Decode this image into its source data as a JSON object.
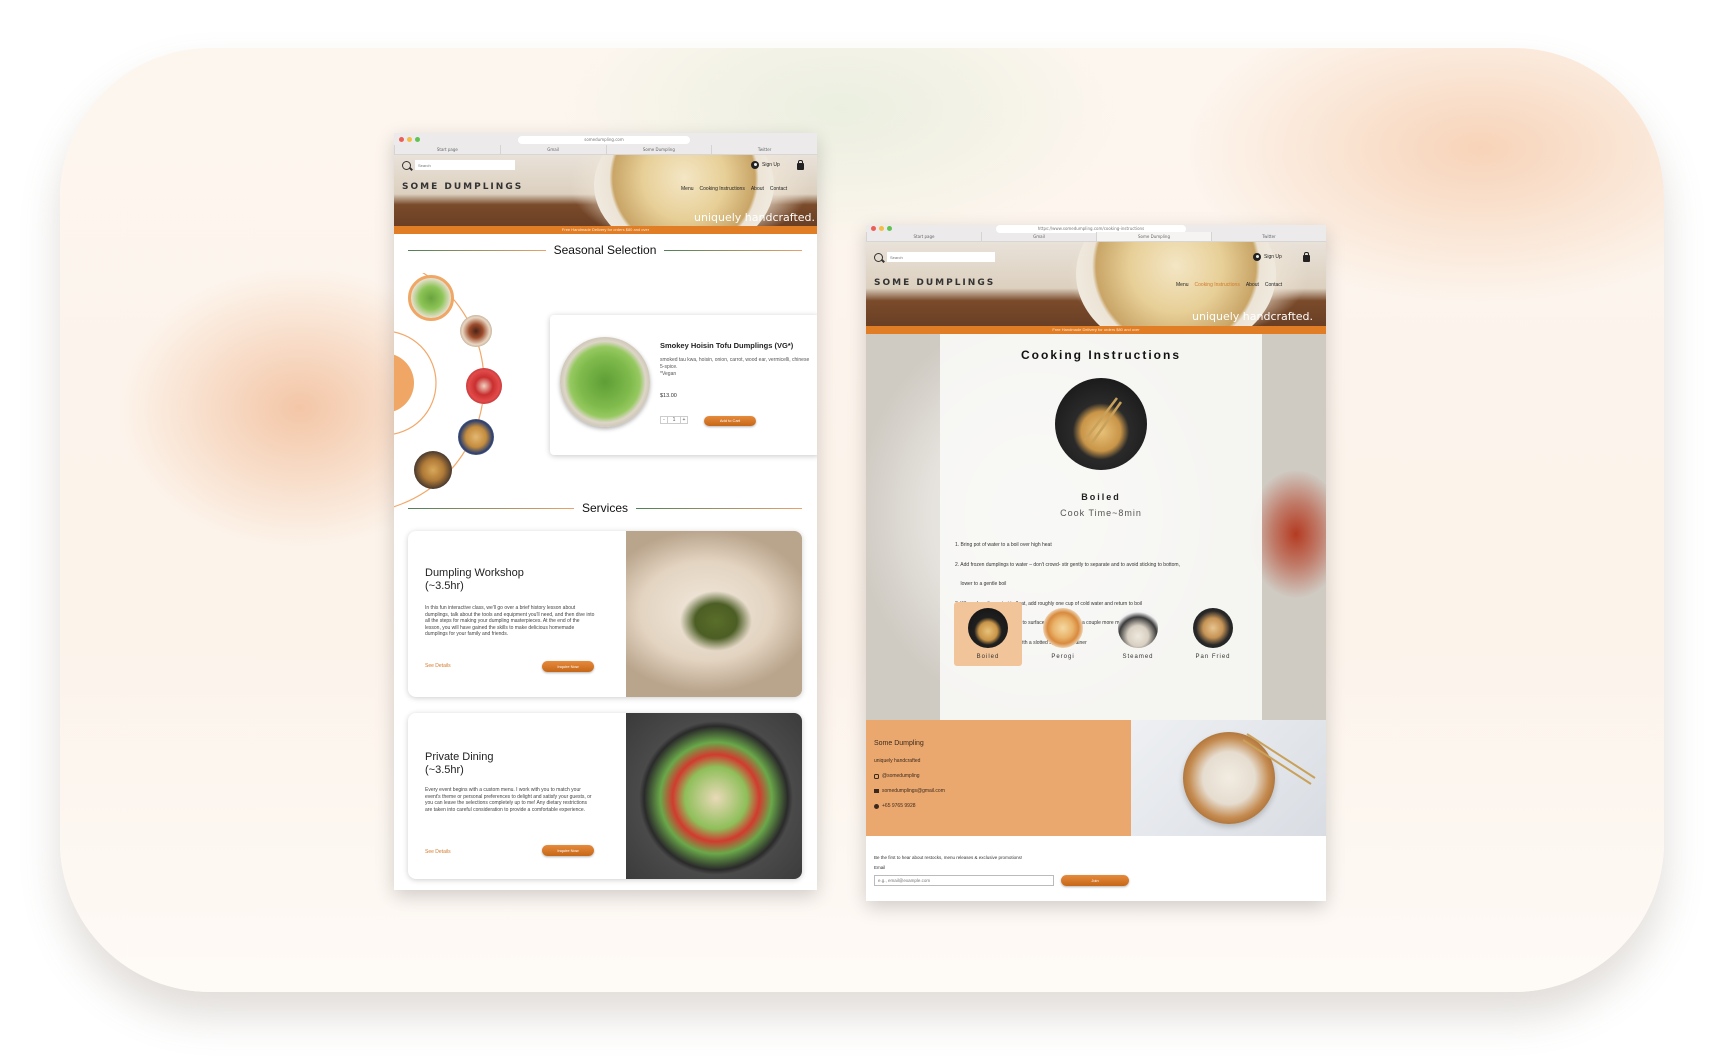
{
  "left_window": {
    "browser": {
      "url": "somedumpling.com",
      "tabs": [
        "Start page",
        "Gmail",
        "Some Dumpling",
        "Twitter"
      ]
    },
    "header": {
      "search_placeholder": "Search",
      "brand": "SOME DUMPLINGS",
      "signup": "Sign Up",
      "nav": [
        "Menu",
        "Cooking Instructions",
        "About",
        "Contact"
      ],
      "tagline": "uniquely handcrafted.",
      "promo": "Free Handmade Delivery for orders $80 and over"
    },
    "seasonal": {
      "title": "Seasonal Selection",
      "product": {
        "name": "Smokey Hoisin Tofu Dumplings (VG*)",
        "description": "smoked tau kwa, hoisin, onion, carrot, wood ear, vermicelli, chinese 5-spice.",
        "note": "*Vegan",
        "price": "$13.00",
        "qty_minus": "-",
        "qty": "1",
        "qty_plus": "+",
        "add_to_cart": "Add to Cart"
      }
    },
    "services": {
      "title": "Services",
      "cards": [
        {
          "title_line1": "Dumpling Workshop",
          "title_line2": "(~3.5hr)",
          "text": "In this fun interactive class, we'll go over a brief history lesson about dumplings, talk about the tools and equipment you'll need, and then dive into all the steps for making your dumpling masterpieces. At the end of the lesson, you will have gained the skills to make delicious homemade dumplings for your family and friends.",
          "details": "See Details",
          "button": "Inquire Now"
        },
        {
          "title_line1": "Private Dining",
          "title_line2": "(~3.5hr)",
          "text": "Every event begins with a custom menu. I work with you to match your event's theme or personal preferences to delight and satisfy your guests, or you can leave the selections completely up to me! Any dietary restrictions are taken into careful consideration to provide a comfortable experience.",
          "details": "See Details",
          "button": "Inquire Now"
        }
      ]
    }
  },
  "right_window": {
    "browser": {
      "url": "https://www.somedumpling.com/cooking-instructions",
      "tabs": [
        "Start page",
        "Gmail",
        "Some Dumpling",
        "Twitter"
      ]
    },
    "header": {
      "search_placeholder": "Search",
      "brand": "SOME DUMPLINGS",
      "signup": "Sign Up",
      "nav": [
        "Menu",
        "Cooking Instructions",
        "About",
        "Contact"
      ],
      "tagline": "uniquely handcrafted.",
      "promo": "Free Handmade Delivery for orders $80 and over"
    },
    "cooking": {
      "title": "Cooking Instructions",
      "method_title": "Boiled",
      "cook_time": "Cook Time~8min",
      "steps": [
        "1. Bring pot of water to a boil over high heat",
        "2. Add frozen dumplings to water – don't crowd- stir gently to separate and to avoid sticking to bottom,",
        "    lower to a gentle boil",
        "3. When dumplings start to float, add roughly one cup of cold water and return to boil",
        "4. After dumplings are floating to surface, allow to boil for a couple more minutes",
        "5. Gently remove dumplings with a slotted spoon or strainer",
        "6. Enjoy!"
      ],
      "methods": [
        "Boiled",
        "Perogi",
        "Steamed",
        "Pan Fried"
      ]
    },
    "footer": {
      "name": "Some Dumpling",
      "tagline": "uniquely handcrafted",
      "instagram": "@somedumpling",
      "email": "somedumplings@gmail.com",
      "phone": "+65 9765 9928",
      "newsletter": "Be the first to hear about restocks, menu releases & exclusive promotions!",
      "email_label": "Email",
      "email_placeholder": "e.g., email@example.com",
      "join": "Join"
    }
  },
  "colors": {
    "accent": "#e07d25",
    "accent_dark": "#c56717",
    "footer_bg": "#eba86e"
  }
}
